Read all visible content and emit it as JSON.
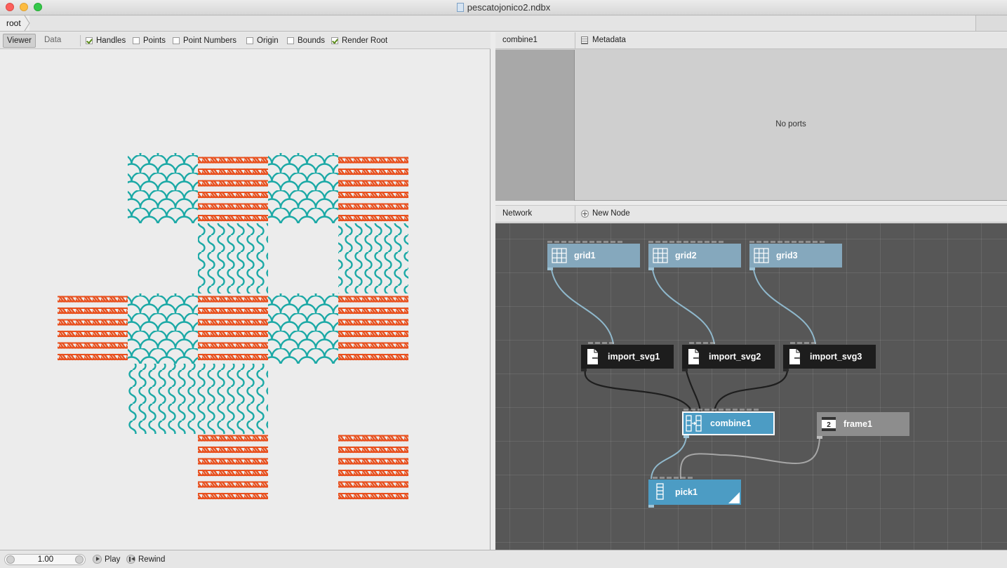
{
  "window": {
    "title": "pescatojonico2.ndbx",
    "doc_icon": "nodebox-document-icon"
  },
  "breadcrumb": {
    "root_label": "root"
  },
  "viewer": {
    "tabs": {
      "viewer": "Viewer",
      "data": "Data",
      "active": "Viewer"
    },
    "toggles": [
      {
        "label": "Handles",
        "checked": true
      },
      {
        "label": "Points",
        "checked": false
      },
      {
        "label": "Point Numbers",
        "checked": false
      },
      {
        "label": "Origin",
        "checked": false
      },
      {
        "label": "Bounds",
        "checked": false
      },
      {
        "label": "Render Root",
        "checked": true
      }
    ],
    "pattern": {
      "colors": {
        "teal": "#1ca9a6",
        "orange": "#e8501e"
      },
      "tile_types": [
        "scales",
        "ropes",
        "waves"
      ],
      "rows": [
        [
          "",
          "",
          "scales",
          "ropes",
          "scales",
          "ropes"
        ],
        [
          "",
          "",
          "",
          "waves",
          "",
          "waves"
        ],
        [
          "",
          "ropes",
          "scales",
          "ropes",
          "scales",
          "ropes"
        ],
        [
          "",
          "",
          "waves",
          "waves",
          "",
          ""
        ],
        [
          "",
          "",
          "",
          "ropes",
          "",
          "ropes"
        ]
      ]
    }
  },
  "ports": {
    "node_name": "combine1",
    "metadata_label": "Metadata",
    "empty_message": "No ports"
  },
  "network": {
    "title": "Network",
    "new_node_label": "New Node",
    "colors": {
      "canvas": "#575757",
      "grid_node": "#85a8bd",
      "import_node": "#1d1d1d",
      "combine_node": "#4c9cc4",
      "frame_node": "#8d8d8d",
      "wire_light": "#8fb8cc",
      "wire_dark": "#1e1e1e",
      "wire_gray": "#a6a6a6"
    },
    "nodes": {
      "grid1": {
        "label": "grid1",
        "icon": "grid-icon"
      },
      "grid2": {
        "label": "grid2",
        "icon": "grid-icon"
      },
      "grid3": {
        "label": "grid3",
        "icon": "grid-icon"
      },
      "import_svg1": {
        "label": "import_svg1",
        "icon": "import-file-icon"
      },
      "import_svg2": {
        "label": "import_svg2",
        "icon": "import-file-icon"
      },
      "import_svg3": {
        "label": "import_svg3",
        "icon": "import-file-icon"
      },
      "combine1": {
        "label": "combine1",
        "icon": "combine-icon",
        "selected": true
      },
      "frame1": {
        "label": "frame1",
        "icon": "frame-counter-icon"
      },
      "pick1": {
        "label": "pick1",
        "icon": "pick-list-icon",
        "rendered": true
      }
    },
    "connections": [
      [
        "grid1",
        "import_svg1"
      ],
      [
        "grid2",
        "import_svg2"
      ],
      [
        "grid3",
        "import_svg3"
      ],
      [
        "import_svg1",
        "combine1"
      ],
      [
        "import_svg2",
        "combine1"
      ],
      [
        "import_svg3",
        "combine1"
      ],
      [
        "combine1",
        "pick1"
      ],
      [
        "frame1",
        "pick1"
      ]
    ]
  },
  "playback": {
    "frame_value": "1.00",
    "play_label": "Play",
    "rewind_label": "Rewind"
  }
}
